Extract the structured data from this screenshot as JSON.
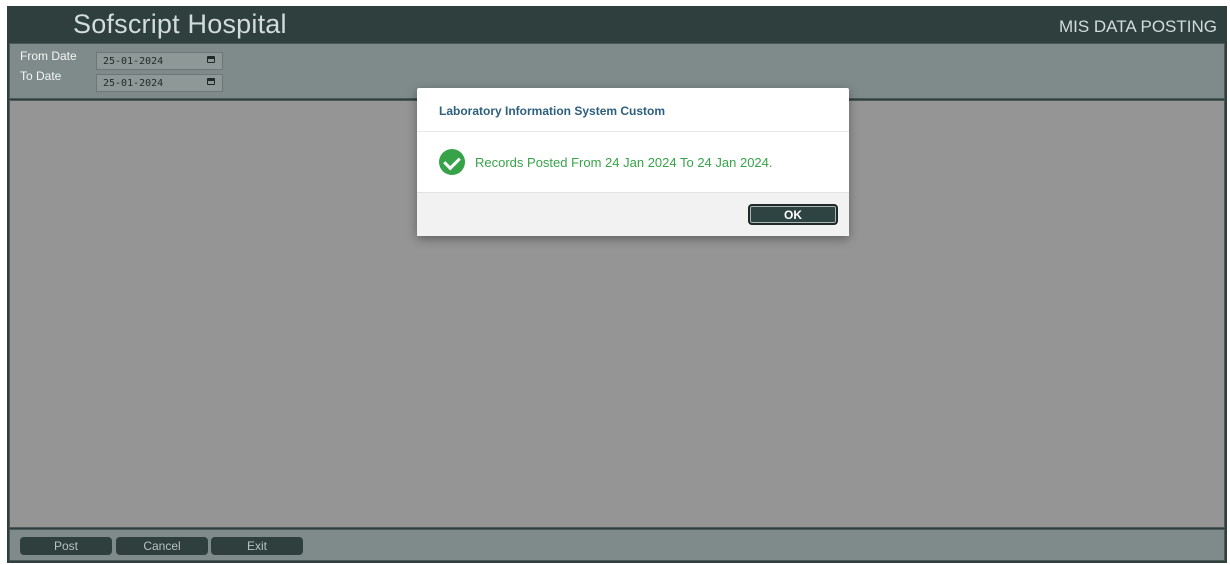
{
  "header": {
    "app_title": "Sofscript Hospital",
    "module_title": "MIS DATA POSTING"
  },
  "filters": {
    "from_date": {
      "label": "From Date",
      "value": "25-01-2024"
    },
    "to_date": {
      "label": "To Date",
      "value": "25-01-2024"
    }
  },
  "footer": {
    "post_label": "Post",
    "cancel_label": "Cancel",
    "exit_label": "Exit"
  },
  "dialog": {
    "title": "Laboratory Information System Custom",
    "message": "Records Posted From 24 Jan 2024 To 24 Jan 2024.",
    "ok_label": "OK",
    "icon": "check-circle-icon"
  },
  "colors": {
    "frame": "#2e3f3d",
    "panel": "#7e8b8a",
    "content": "#959595",
    "success": "#37a349",
    "dialog_title": "#2d5f7e"
  }
}
